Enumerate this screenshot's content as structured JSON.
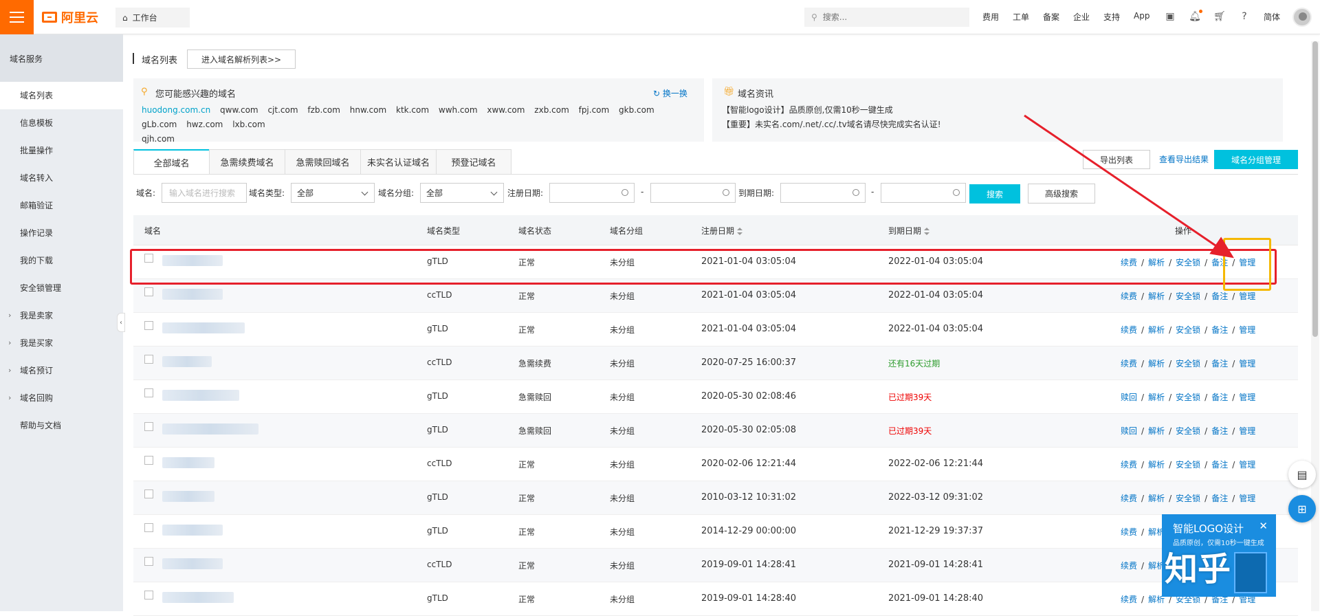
{
  "topbar": {
    "logo_text": "阿里云",
    "workbench": "工作台",
    "search_placeholder": "搜索...",
    "nav": [
      "费用",
      "工单",
      "备案",
      "企业",
      "支持",
      "App"
    ],
    "lang": "简体"
  },
  "sidebar": {
    "title": "域名服务",
    "items": [
      {
        "label": "域名列表",
        "active": true,
        "expandable": false
      },
      {
        "label": "信息模板",
        "expandable": false
      },
      {
        "label": "批量操作",
        "expandable": false
      },
      {
        "label": "域名转入",
        "expandable": false
      },
      {
        "label": "邮箱验证",
        "expandable": false
      },
      {
        "label": "操作记录",
        "expandable": false
      },
      {
        "label": "我的下载",
        "expandable": false
      },
      {
        "label": "安全锁管理",
        "expandable": false
      },
      {
        "label": "我是卖家",
        "expandable": true
      },
      {
        "label": "我是买家",
        "expandable": true
      },
      {
        "label": "域名预订",
        "expandable": true
      },
      {
        "label": "域名回购",
        "expandable": true
      },
      {
        "label": "帮助与文档",
        "expandable": false
      }
    ]
  },
  "header": {
    "title": "域名列表",
    "dns_button": "进入域名解析列表>>"
  },
  "interest": {
    "title": "您可能感兴趣的域名",
    "refresh": "换一换",
    "domains": [
      "huodong.com.cn",
      "qww.com",
      "cjt.com",
      "fzb.com",
      "hnw.com",
      "ktk.com",
      "wwh.com",
      "xww.com",
      "zxb.com",
      "fpj.com",
      "gkb.com",
      "gLb.com",
      "hwz.com",
      "lxb.com",
      "qjh.com"
    ]
  },
  "news": {
    "title": "域名资讯",
    "lines": [
      "【智能logo设计】品质原创,仅需10秒一键生成",
      "【重要】未实名.com/.net/.cc/.tv域名请尽快完成实名认证!"
    ]
  },
  "tabs": [
    "全部域名",
    "急需续费域名",
    "急需赎回域名",
    "未实名认证域名",
    "预登记域名"
  ],
  "actions": {
    "export": "导出列表",
    "view_export": "查看导出结果",
    "group_manage": "域名分组管理"
  },
  "filters": {
    "domain_label": "域名:",
    "domain_placeholder": "输入域名进行搜索",
    "type_label": "域名类型:",
    "type_value": "全部",
    "group_label": "域名分组:",
    "group_value": "全部",
    "reg_label": "注册日期:",
    "exp_label": "到期日期:",
    "dash": "-",
    "search": "搜索",
    "advanced": "高级搜索"
  },
  "table": {
    "headers": [
      "域名",
      "域名类型",
      "域名状态",
      "域名分组",
      "注册日期",
      "到期日期",
      "操作"
    ],
    "rows": [
      {
        "type": "gTLD",
        "status": "正常",
        "group": "未分组",
        "reg": "2021-01-04 03:05:04",
        "exp": "2022-01-04 03:05:04",
        "exp_style": "normal",
        "first_op": "续费"
      },
      {
        "type": "ccTLD",
        "status": "正常",
        "group": "未分组",
        "reg": "2021-01-04 03:05:04",
        "exp": "2022-01-04 03:05:04",
        "exp_style": "normal",
        "first_op": "续费"
      },
      {
        "type": "gTLD",
        "status": "正常",
        "group": "未分组",
        "reg": "2021-01-04 03:05:04",
        "exp": "2022-01-04 03:05:04",
        "exp_style": "normal",
        "first_op": "续费"
      },
      {
        "type": "ccTLD",
        "status": "急需续费",
        "group": "未分组",
        "reg": "2020-07-25 16:00:37",
        "exp": "还有16天过期",
        "exp_style": "green",
        "first_op": "续费"
      },
      {
        "type": "gTLD",
        "status": "急需赎回",
        "group": "未分组",
        "reg": "2020-05-30 02:08:46",
        "exp": "已过期39天",
        "exp_style": "red",
        "first_op": "赎回"
      },
      {
        "type": "gTLD",
        "status": "急需赎回",
        "group": "未分组",
        "reg": "2020-05-30 02:05:08",
        "exp": "已过期39天",
        "exp_style": "red",
        "first_op": "赎回"
      },
      {
        "type": "ccTLD",
        "status": "正常",
        "group": "未分组",
        "reg": "2020-02-06 12:21:44",
        "exp": "2022-02-06 12:21:44",
        "exp_style": "normal",
        "first_op": "续费"
      },
      {
        "type": "gTLD",
        "status": "正常",
        "group": "未分组",
        "reg": "2010-03-12 10:31:02",
        "exp": "2022-03-12 09:31:02",
        "exp_style": "normal",
        "first_op": "续费"
      },
      {
        "type": "gTLD",
        "status": "正常",
        "group": "未分组",
        "reg": "2014-12-29 00:00:00",
        "exp": "2021-12-29 19:37:37",
        "exp_style": "normal",
        "first_op": "续费"
      },
      {
        "type": "ccTLD",
        "status": "正常",
        "group": "未分组",
        "reg": "2019-09-01 14:28:41",
        "exp": "2021-09-01 14:28:41",
        "exp_style": "normal",
        "first_op": "续费"
      },
      {
        "type": "gTLD",
        "status": "正常",
        "group": "未分组",
        "reg": "2019-09-01 14:28:40",
        "exp": "2021-09-01 14:28:40",
        "exp_style": "normal",
        "first_op": "续费"
      }
    ],
    "ops": [
      "解析",
      "安全锁",
      "备注",
      "管理"
    ],
    "op_sep": "/"
  },
  "ad": {
    "title": "智能LOGO设计",
    "subtitle": "品质原创，仅需10秒一键生成"
  },
  "watermark": "知乎",
  "colors": {
    "brand": "#ff6a00",
    "accent": "#00c1de",
    "link": "#0073c6",
    "highlight_red": "#e6202b",
    "highlight_yellow": "#f5b800"
  }
}
